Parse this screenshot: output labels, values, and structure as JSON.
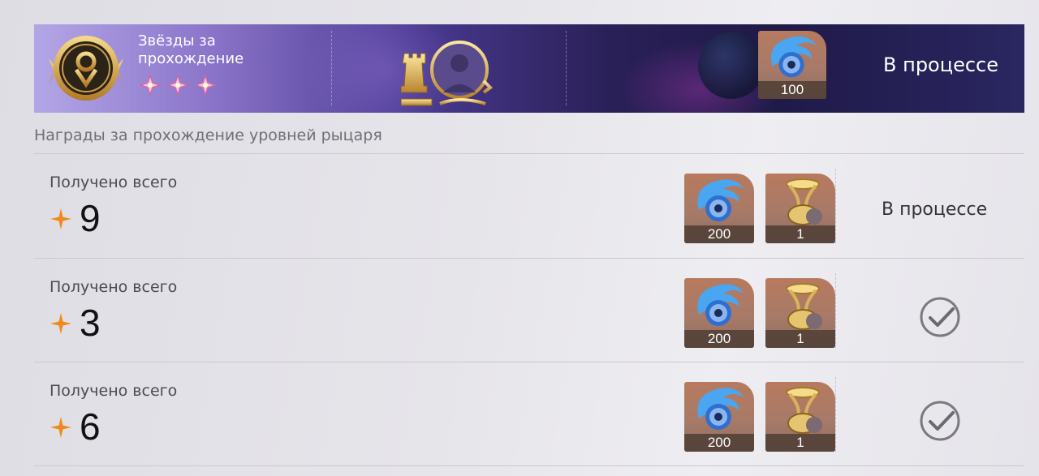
{
  "banner": {
    "title": "Звёзды за прохождение",
    "stars": 3,
    "reward": {
      "icon": "blue-orb-icon",
      "count": "100"
    },
    "status": "В процессе"
  },
  "section": {
    "title": "Награды за прохождение уровней рыцаря"
  },
  "rows": [
    {
      "label": "Получено всего",
      "stars": "9",
      "rewards": [
        {
          "icon": "blue-orb-icon",
          "count": "200"
        },
        {
          "icon": "golden-hourglass-icon",
          "count": "1"
        }
      ],
      "status": "В процессе",
      "claimed": false
    },
    {
      "label": "Получено всего",
      "stars": "3",
      "rewards": [
        {
          "icon": "blue-orb-icon",
          "count": "200"
        },
        {
          "icon": "golden-hourglass-icon",
          "count": "1"
        }
      ],
      "status": "",
      "claimed": true
    },
    {
      "label": "Получено всего",
      "stars": "6",
      "rewards": [
        {
          "icon": "blue-orb-icon",
          "count": "200"
        },
        {
          "icon": "golden-hourglass-icon",
          "count": "1"
        }
      ],
      "status": "",
      "claimed": true
    }
  ],
  "colors": {
    "accent_star": "#f08a1e",
    "banner_dark": "#1f1a48",
    "banner_light": "#b3a6e6"
  }
}
